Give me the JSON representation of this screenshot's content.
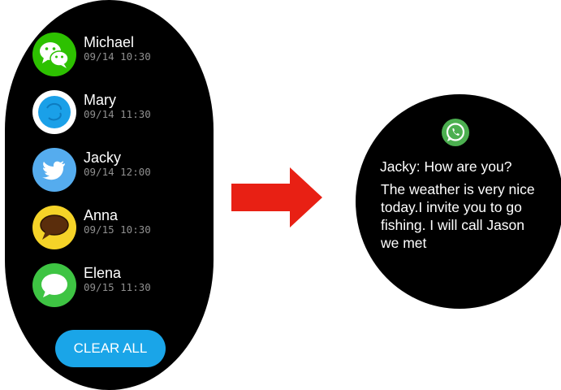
{
  "notifications": [
    {
      "name": "Michael",
      "time": "09/14 10:30",
      "app_icon": "wechat-icon",
      "icon_color": "#2dc100"
    },
    {
      "name": "Mary",
      "time": "09/14 11:30",
      "app_icon": "skype-icon",
      "icon_color": "#1aa0e8"
    },
    {
      "name": "Jacky",
      "time": "09/14 12:00",
      "app_icon": "twitter-icon",
      "icon_color": "#55acee"
    },
    {
      "name": "Anna",
      "time": "09/15 10:30",
      "app_icon": "chat-bubble-icon",
      "icon_color": "#f5d328"
    },
    {
      "name": "Elena",
      "time": "09/15 11:30",
      "app_icon": "messages-icon",
      "icon_color": "#3ec443"
    }
  ],
  "clear_button": {
    "label": "CLEAR ALL",
    "color": "#1aa5e8"
  },
  "arrow_color": "#e82014",
  "message_detail": {
    "app_icon": "whatsapp-icon",
    "icon_color": "#4caf50",
    "sender_line": "Jacky: How are you?",
    "body": "The weather is very nice today.I invite you to go fishing. I will call Jason we met"
  }
}
